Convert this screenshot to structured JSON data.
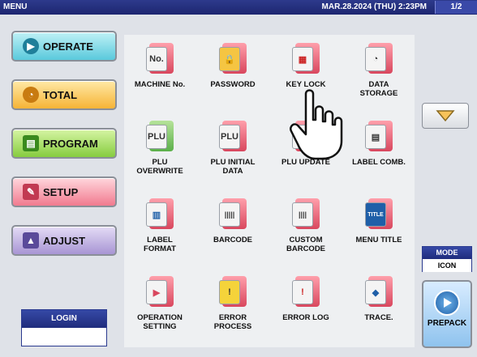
{
  "titlebar": {
    "title": "MENU",
    "datetime": "MAR.28.2024 (THU)  2:23PM",
    "page": "1/2"
  },
  "leftmenu": [
    {
      "label": "OPERATE",
      "icon": "operate-icon"
    },
    {
      "label": "TOTAL",
      "icon": "total-icon"
    },
    {
      "label": "PROGRAM",
      "icon": "program-icon"
    },
    {
      "label": "SETUP",
      "icon": "setup-icon"
    },
    {
      "label": "ADJUST",
      "icon": "adjust-icon"
    }
  ],
  "login": {
    "label": "LOGIN",
    "value": ""
  },
  "grid": [
    {
      "label": "MACHINE No.",
      "icon": "machine-no-icon",
      "glyph": "No."
    },
    {
      "label": "PASSWORD",
      "icon": "lock-icon",
      "glyph": "🔒"
    },
    {
      "label": "KEY LOCK",
      "icon": "key-lock-icon",
      "glyph": "▦"
    },
    {
      "label": "DATA\nSTORAGE",
      "icon": "data-storage-icon",
      "glyph": "◔"
    },
    {
      "label": "PLU\nOVERWRITE",
      "icon": "plu-overwrite-icon",
      "glyph": "PLU"
    },
    {
      "label": "PLU INITIAL\nDATA",
      "icon": "plu-initial-icon",
      "glyph": "PLU"
    },
    {
      "label": "PLU UPDATE",
      "icon": "plu-update-icon",
      "glyph": "↑"
    },
    {
      "label": "LABEL COMB.",
      "icon": "label-comb-icon",
      "glyph": "▤"
    },
    {
      "label": "LABEL\nFORMAT",
      "icon": "label-format-icon",
      "glyph": "▥"
    },
    {
      "label": "BARCODE",
      "icon": "barcode-icon",
      "glyph": "|||||"
    },
    {
      "label": "CUSTOM\nBARCODE",
      "icon": "custom-barcode-icon",
      "glyph": "||||"
    },
    {
      "label": "MENU TITLE",
      "icon": "menu-title-icon",
      "glyph": "TITLE"
    },
    {
      "label": "OPERATION\nSETTING",
      "icon": "operation-setting-icon",
      "glyph": "▶"
    },
    {
      "label": "ERROR\nPROCESS",
      "icon": "error-process-icon",
      "glyph": "!"
    },
    {
      "label": "ERROR LOG",
      "icon": "error-log-icon",
      "glyph": "!"
    },
    {
      "label": "TRACE.",
      "icon": "trace-icon",
      "glyph": "◆"
    }
  ],
  "right": {
    "mode_label": "MODE",
    "mode_value": "ICON",
    "prepack_label": "PREPACK"
  },
  "colors": {
    "titlebar": "#1d2670",
    "grid_bg": "#eef0f2",
    "icon_red": "#d9475e"
  }
}
